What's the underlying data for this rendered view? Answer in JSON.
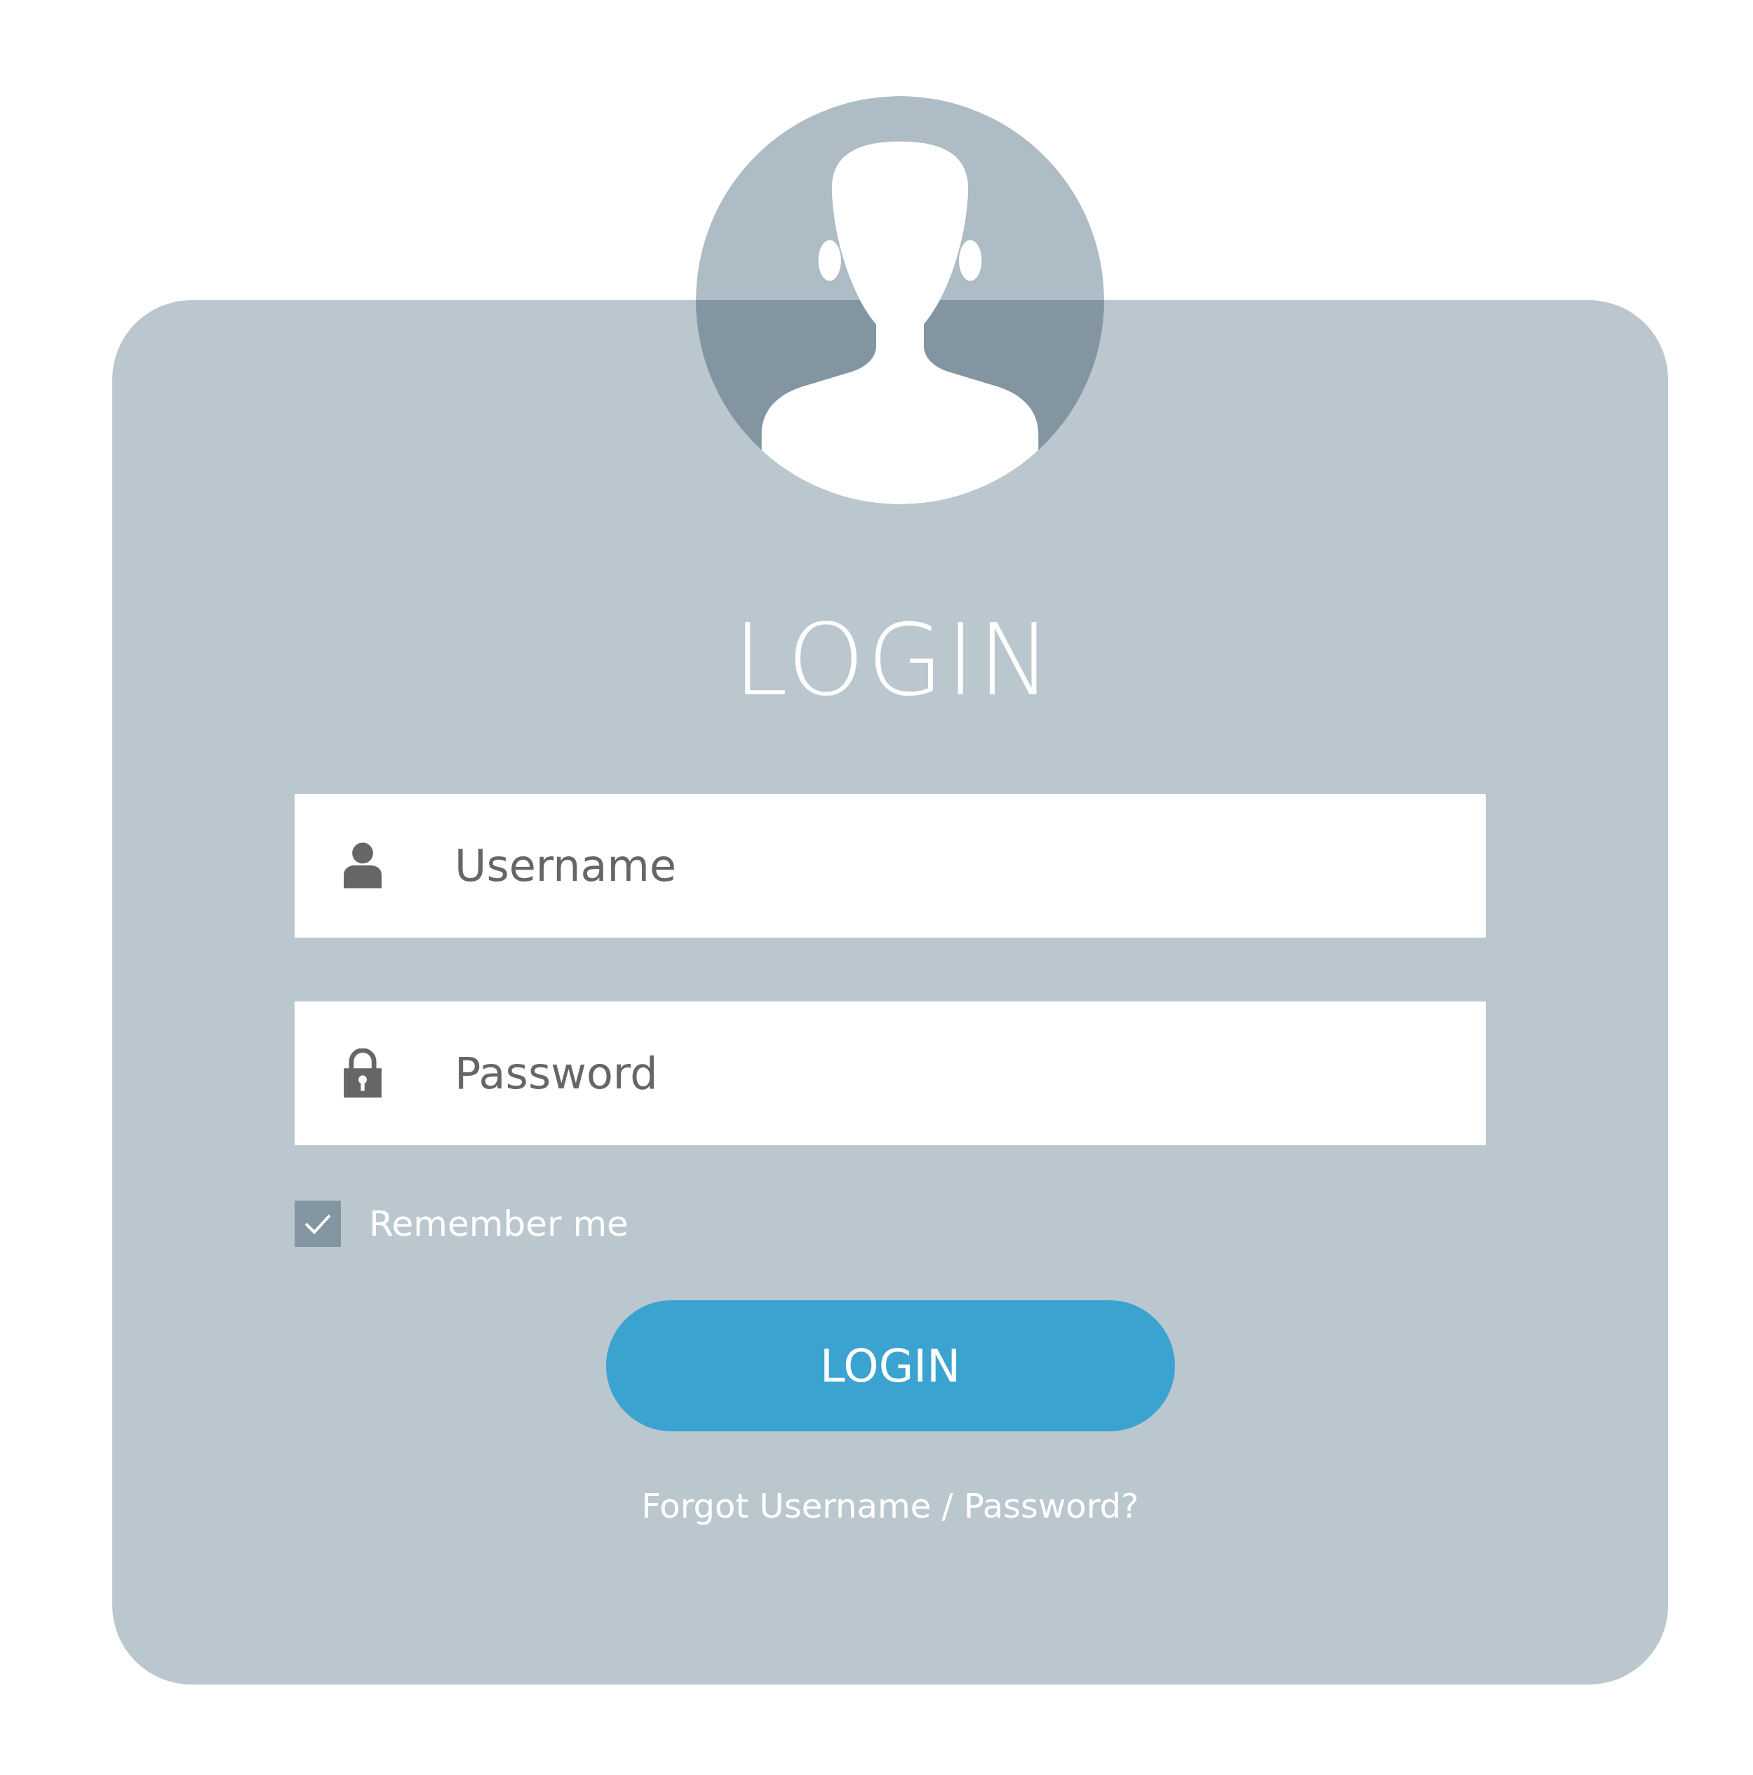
{
  "title": "LOGIN",
  "fields": [
    {
      "kind": "user",
      "placeholder": "Username"
    },
    {
      "kind": "lock",
      "placeholder": "Password"
    }
  ],
  "remember": {
    "label": "Remember me",
    "checked": true
  },
  "login_button": "LOGIN",
  "forgot_link": "Forgot Username / Password?"
}
